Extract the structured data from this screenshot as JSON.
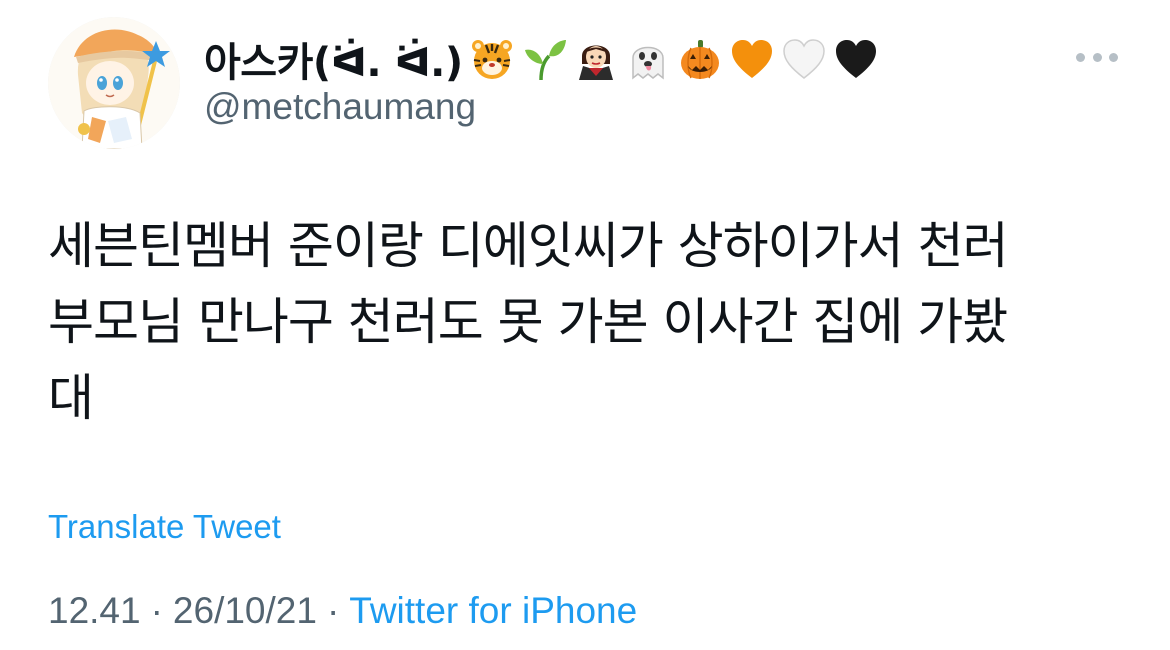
{
  "author": {
    "display_name": "아스카(ᐛ. ᐛ.)",
    "handle": "@metchaumang",
    "emojis": [
      "tiger-face",
      "seedling",
      "vampire-woman",
      "ghost",
      "jack-o-lantern",
      "orange-heart",
      "white-heart",
      "black-heart"
    ]
  },
  "tweet": {
    "lines": [
      "세븐틴멤버 준이랑 디에잇씨가 상하이가서 천러",
      "부모님 만나구 천러도 못 가본 이사간 집에 가봤",
      "대"
    ]
  },
  "translate_label": "Translate Tweet",
  "meta": {
    "time": "12.41",
    "separator": "·",
    "date": "26/10/21",
    "source": "Twitter for iPhone"
  },
  "colors": {
    "link": "#1d9bf0",
    "secondary": "#536471",
    "text": "#0f1419"
  }
}
